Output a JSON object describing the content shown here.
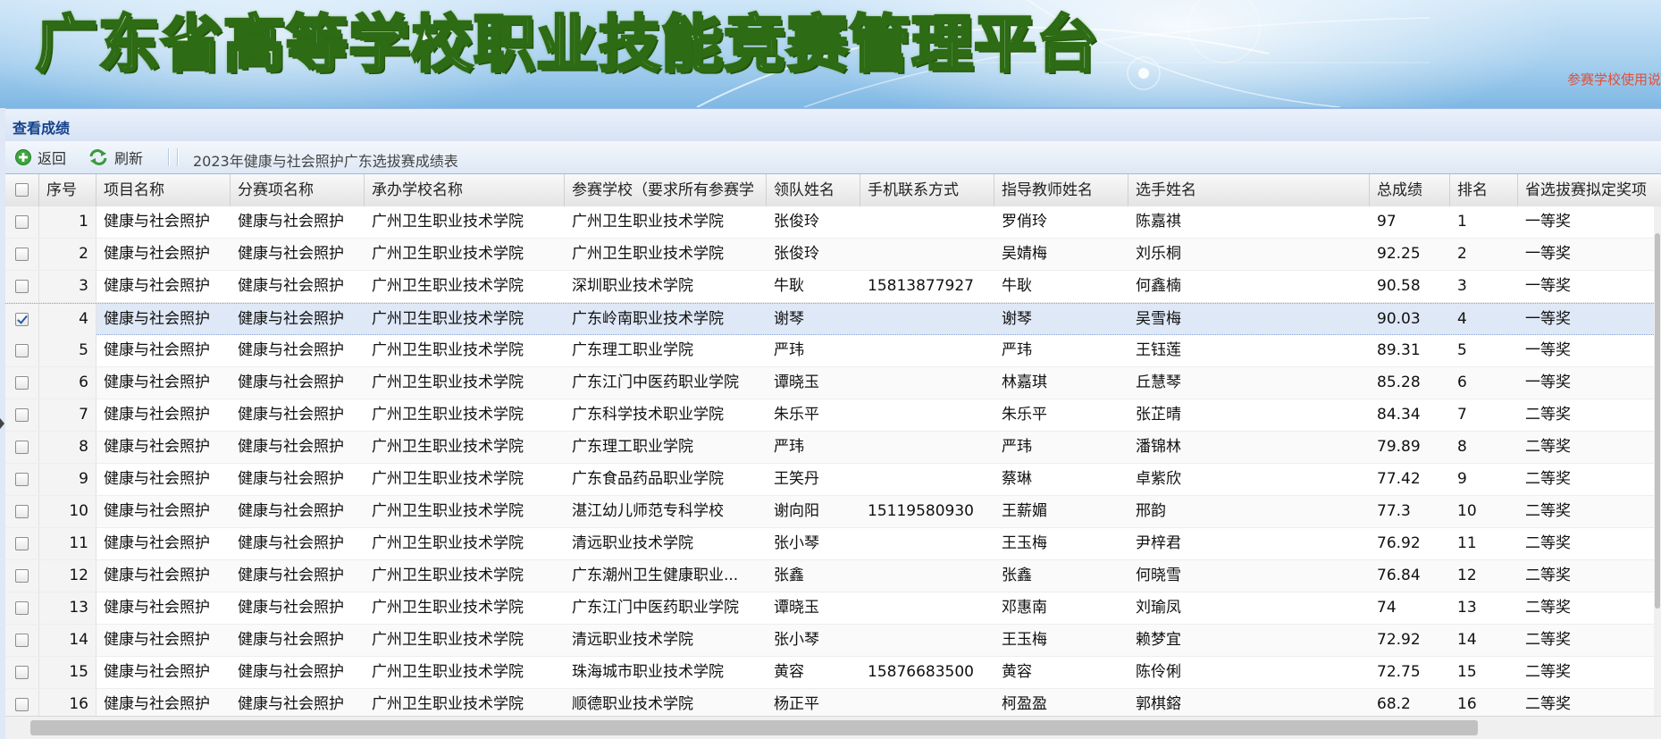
{
  "banner": {
    "title": "广东省高等学校职业技能竞赛管理平台",
    "notice": "参赛学校使用说"
  },
  "panel": {
    "title": "查看成绩"
  },
  "toolbar": {
    "back_label": "返回",
    "refresh_label": "刷新",
    "caption": "2023年健康与社会照护广东选拔赛成绩表"
  },
  "columns": {
    "seq": "序号",
    "project": "项目名称",
    "sub_project": "分赛项名称",
    "host_school": "承办学校名称",
    "school": "参赛学校（要求所有参赛学",
    "leader": "领队姓名",
    "phone": "手机联系方式",
    "teacher": "指导教师姓名",
    "player": "选手姓名",
    "score": "总成绩",
    "rank": "排名",
    "award": "省选拔赛拟定奖项"
  },
  "rows": [
    {
      "seq": "1",
      "project": "健康与社会照护",
      "sub_project": "健康与社会照护",
      "host_school": "广州卫生职业技术学院",
      "school": "广州卫生职业技术学院",
      "leader": "张俊玲",
      "phone": "",
      "teacher": "罗俏玲",
      "player": "陈嘉祺",
      "score": "97",
      "rank": "1",
      "award": "一等奖",
      "checked": false
    },
    {
      "seq": "2",
      "project": "健康与社会照护",
      "sub_project": "健康与社会照护",
      "host_school": "广州卫生职业技术学院",
      "school": "广州卫生职业技术学院",
      "leader": "张俊玲",
      "phone": "",
      "teacher": "吴婧梅",
      "player": "刘乐桐",
      "score": "92.25",
      "rank": "2",
      "award": "一等奖",
      "checked": false
    },
    {
      "seq": "3",
      "project": "健康与社会照护",
      "sub_project": "健康与社会照护",
      "host_school": "广州卫生职业技术学院",
      "school": "深圳职业技术学院",
      "leader": "牛耿",
      "phone": "15813877927",
      "teacher": "牛耿",
      "player": "何鑫楠",
      "score": "90.58",
      "rank": "3",
      "award": "一等奖",
      "checked": false
    },
    {
      "seq": "4",
      "project": "健康与社会照护",
      "sub_project": "健康与社会照护",
      "host_school": "广州卫生职业技术学院",
      "school": "广东岭南职业技术学院",
      "leader": "谢琴",
      "phone": "",
      "teacher": "谢琴",
      "player": "吴雪梅",
      "score": "90.03",
      "rank": "4",
      "award": "一等奖",
      "checked": true
    },
    {
      "seq": "5",
      "project": "健康与社会照护",
      "sub_project": "健康与社会照护",
      "host_school": "广州卫生职业技术学院",
      "school": "广东理工职业学院",
      "leader": "严玮",
      "phone": "",
      "teacher": "严玮",
      "player": "王钰莲",
      "score": "89.31",
      "rank": "5",
      "award": "一等奖",
      "checked": false
    },
    {
      "seq": "6",
      "project": "健康与社会照护",
      "sub_project": "健康与社会照护",
      "host_school": "广州卫生职业技术学院",
      "school": "广东江门中医药职业学院",
      "leader": "谭晓玉",
      "phone": "",
      "teacher": "林嘉琪",
      "player": "丘慧琴",
      "score": "85.28",
      "rank": "6",
      "award": "一等奖",
      "checked": false
    },
    {
      "seq": "7",
      "project": "健康与社会照护",
      "sub_project": "健康与社会照护",
      "host_school": "广州卫生职业技术学院",
      "school": "广东科学技术职业学院",
      "leader": "朱乐平",
      "phone": "",
      "teacher": "朱乐平",
      "player": "张芷晴",
      "score": "84.34",
      "rank": "7",
      "award": "二等奖",
      "checked": false
    },
    {
      "seq": "8",
      "project": "健康与社会照护",
      "sub_project": "健康与社会照护",
      "host_school": "广州卫生职业技术学院",
      "school": "广东理工职业学院",
      "leader": "严玮",
      "phone": "",
      "teacher": "严玮",
      "player": "潘锦林",
      "score": "79.89",
      "rank": "8",
      "award": "二等奖",
      "checked": false
    },
    {
      "seq": "9",
      "project": "健康与社会照护",
      "sub_project": "健康与社会照护",
      "host_school": "广州卫生职业技术学院",
      "school": "广东食品药品职业学院",
      "leader": "王笑丹",
      "phone": "",
      "teacher": "蔡琳",
      "player": "卓紫欣",
      "score": "77.42",
      "rank": "9",
      "award": "二等奖",
      "checked": false
    },
    {
      "seq": "10",
      "project": "健康与社会照护",
      "sub_project": "健康与社会照护",
      "host_school": "广州卫生职业技术学院",
      "school": "湛江幼儿师范专科学校",
      "leader": "谢向阳",
      "phone": "15119580930",
      "teacher": "王薪媚",
      "player": "邢韵",
      "score": "77.3",
      "rank": "10",
      "award": "二等奖",
      "checked": false
    },
    {
      "seq": "11",
      "project": "健康与社会照护",
      "sub_project": "健康与社会照护",
      "host_school": "广州卫生职业技术学院",
      "school": "清远职业技术学院",
      "leader": "张小琴",
      "phone": "",
      "teacher": "王玉梅",
      "player": "尹梓君",
      "score": "76.92",
      "rank": "11",
      "award": "二等奖",
      "checked": false
    },
    {
      "seq": "12",
      "project": "健康与社会照护",
      "sub_project": "健康与社会照护",
      "host_school": "广州卫生职业技术学院",
      "school": "广东潮州卫生健康职业...",
      "leader": "张鑫",
      "phone": "",
      "teacher": "张鑫",
      "player": "何晓雪",
      "score": "76.84",
      "rank": "12",
      "award": "二等奖",
      "checked": false
    },
    {
      "seq": "13",
      "project": "健康与社会照护",
      "sub_project": "健康与社会照护",
      "host_school": "广州卫生职业技术学院",
      "school": "广东江门中医药职业学院",
      "leader": "谭晓玉",
      "phone": "",
      "teacher": "邓惠南",
      "player": "刘瑜凤",
      "score": "74",
      "rank": "13",
      "award": "二等奖",
      "checked": false
    },
    {
      "seq": "14",
      "project": "健康与社会照护",
      "sub_project": "健康与社会照护",
      "host_school": "广州卫生职业技术学院",
      "school": "清远职业技术学院",
      "leader": "张小琴",
      "phone": "",
      "teacher": "王玉梅",
      "player": "赖梦宜",
      "score": "72.92",
      "rank": "14",
      "award": "二等奖",
      "checked": false
    },
    {
      "seq": "15",
      "project": "健康与社会照护",
      "sub_project": "健康与社会照护",
      "host_school": "广州卫生职业技术学院",
      "school": "珠海城市职业技术学院",
      "leader": "黄容",
      "phone": "15876683500",
      "teacher": "黄容",
      "player": "陈伶俐",
      "score": "72.75",
      "rank": "15",
      "award": "二等奖",
      "checked": false
    },
    {
      "seq": "16",
      "project": "健康与社会照护",
      "sub_project": "健康与社会照护",
      "host_school": "广州卫生职业技术学院",
      "school": "顺德职业技术学院",
      "leader": "杨正平",
      "phone": "",
      "teacher": "柯盈盈",
      "player": "郭棋鎔",
      "score": "68.2",
      "rank": "16",
      "award": "二等奖",
      "checked": false
    }
  ]
}
